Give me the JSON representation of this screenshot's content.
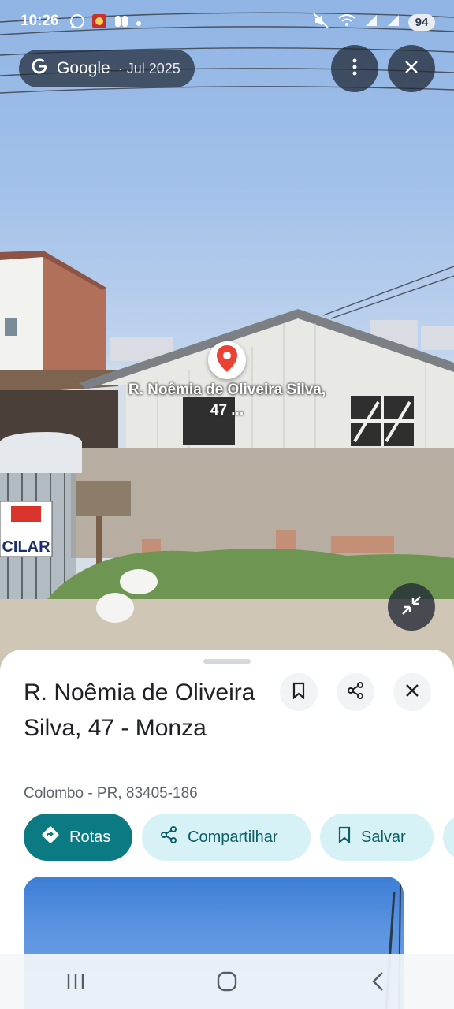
{
  "status_bar": {
    "time": "10:26",
    "battery": "94",
    "notification_icons": [
      "whatsapp-icon",
      "game-icon",
      "quote-icon",
      "dot-icon"
    ],
    "system_icons": [
      "mute-icon",
      "wifi-icon",
      "signal-icon",
      "signal-icon-2"
    ]
  },
  "street_view": {
    "provider": "Google",
    "date": "· Jul 2025",
    "pin_label": "R. Noêmia de Oliveira Silva, 47 ...",
    "sign_text": "CILAR"
  },
  "place": {
    "title": "R. Noêmia de Oliveira Silva, 47 - Monza",
    "subtitle": "Colombo - PR, 83405-186"
  },
  "actions": {
    "routes": "Rotas",
    "share": "Compartilhar",
    "save": "Salvar"
  },
  "colors": {
    "accent": "#0b7a82",
    "chip_bg": "#d6f2f6",
    "chip_text": "#0d5d66",
    "pin_red": "#ea4335"
  }
}
